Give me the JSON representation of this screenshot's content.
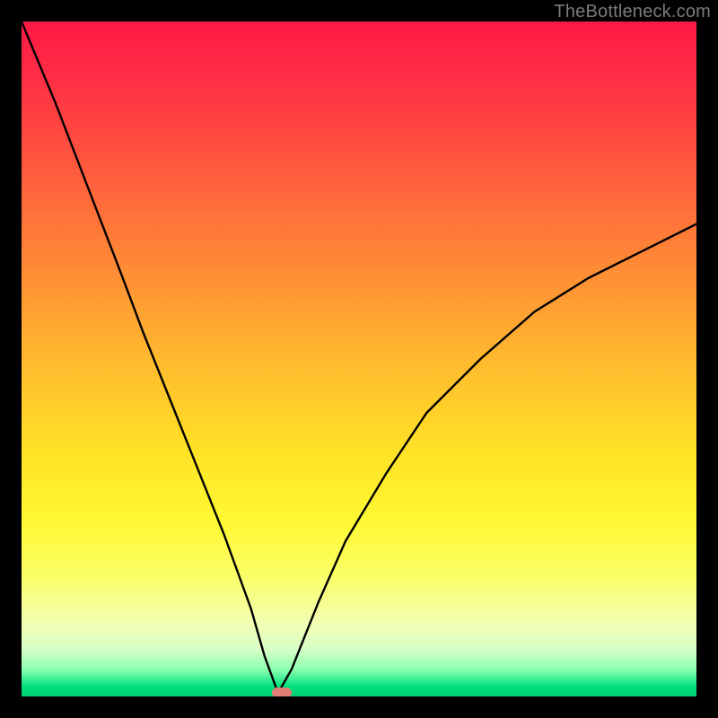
{
  "watermark": "TheBottleneck.com",
  "chart_data": {
    "type": "line",
    "title": "",
    "xlabel": "",
    "ylabel": "",
    "xlim": [
      0,
      100
    ],
    "ylim": [
      0,
      100
    ],
    "grid": false,
    "background_gradient": {
      "direction": "vertical",
      "stops": [
        {
          "pos": 0.0,
          "color": "#ff1a44"
        },
        {
          "pos": 0.5,
          "color": "#ffb92e"
        },
        {
          "pos": 0.8,
          "color": "#fff833"
        },
        {
          "pos": 0.95,
          "color": "#d8ffc8"
        },
        {
          "pos": 1.0,
          "color": "#00d070"
        }
      ]
    },
    "curve": {
      "description": "V-shaped bottleneck curve with minimum near x≈38. Left branch rises steeply from minimum to top-left; right branch rises more gently toward upper-right, ending near y≈70 at x=100.",
      "x": [
        0,
        5,
        10,
        15,
        18,
        22,
        26,
        30,
        34,
        36,
        38,
        40,
        42,
        44,
        48,
        54,
        60,
        68,
        76,
        84,
        92,
        100
      ],
      "y": [
        100,
        88,
        75,
        62,
        54,
        44,
        34,
        24,
        13,
        6,
        0.5,
        4,
        9,
        14,
        23,
        33,
        42,
        50,
        57,
        62,
        66,
        70
      ]
    },
    "marker": {
      "x": 38.5,
      "y": 0.5,
      "type": "rounded-pill",
      "color": "#e17f74",
      "label": ""
    }
  }
}
